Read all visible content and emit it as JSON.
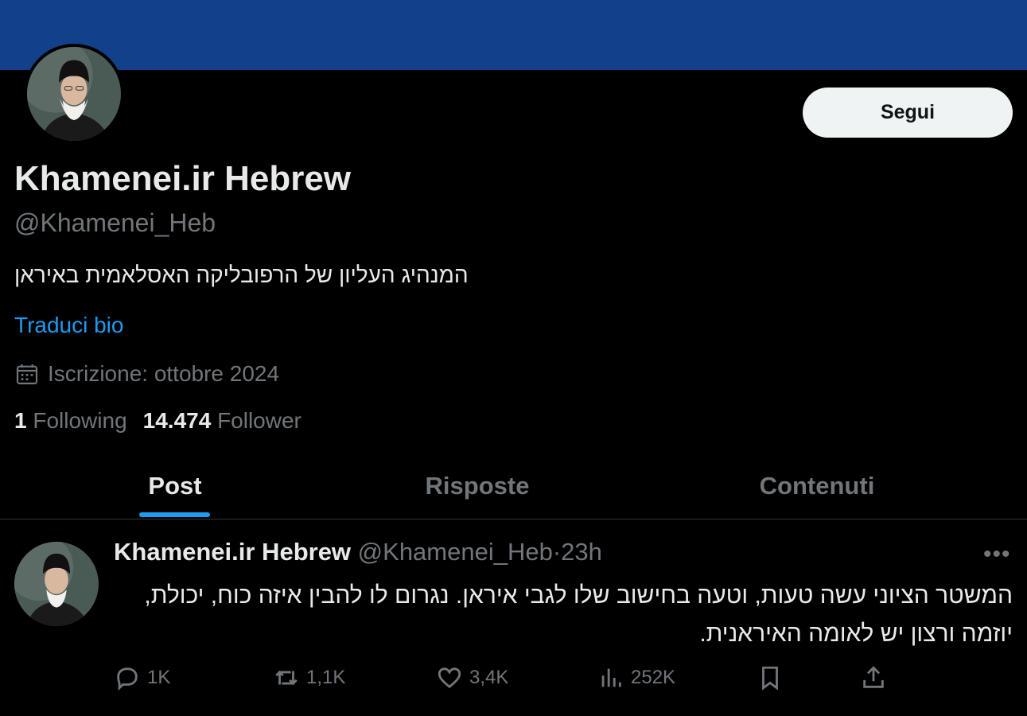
{
  "profile": {
    "display_name": "Khamenei.ir Hebrew",
    "handle": "@Khamenei_Heb",
    "bio": "המנהיג העליון של הרפובליקה האסלאמית באיראן",
    "translate_bio": "Traduci bio",
    "joined": "Iscrizione: ottobre 2024",
    "following_count": "1",
    "following_label": "Following",
    "follower_count": "14.474",
    "follower_label": "Follower",
    "follow_button": "Segui"
  },
  "tabs": [
    {
      "label": "Post",
      "active": true
    },
    {
      "label": "Risposte",
      "active": false
    },
    {
      "label": "Contenuti",
      "active": false
    }
  ],
  "tweet": {
    "author": "Khamenei.ir Hebrew",
    "handle": "@Khamenei_Heb",
    "separator": "·",
    "time": "23h",
    "text": "המשטר הציוני עשה טעות, וטעה בחישוב שלו לגבי איראן. נגרום לו להבין איזה כוח, יכולת, יוזמה ורצון יש לאומה האיראנית.",
    "more_icon": "•••",
    "actions": {
      "replies": "1K",
      "reposts": "1,1K",
      "likes": "3,4K",
      "views": "252K"
    }
  },
  "colors": {
    "banner": "#12408a",
    "accent": "#1d9bf0",
    "background": "#000000",
    "muted": "#71767b"
  },
  "icons": [
    "calendar-icon",
    "reply-icon",
    "repost-icon",
    "like-icon",
    "views-icon",
    "bookmark-icon",
    "share-icon",
    "more-icon"
  ]
}
